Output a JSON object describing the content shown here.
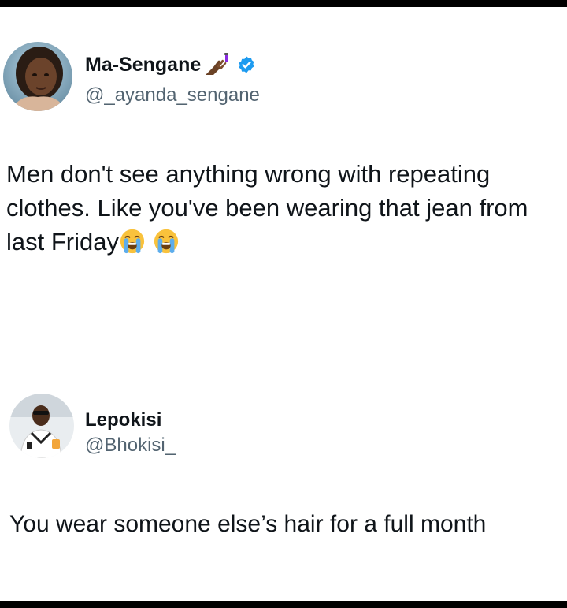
{
  "posts": [
    {
      "display_name": "Ma-Sengane",
      "handle": "@_ayanda_sengane",
      "verified": true,
      "name_icon": "nail-polish-emoji-icon",
      "text_lines": [
        "Men don't see anything wrong with repeating",
        "clothes. Like you've been wearing that jean from",
        "last Friday"
      ],
      "trailing_emojis": [
        "loudly-crying-face-icon",
        "loudly-crying-face-icon"
      ]
    },
    {
      "display_name": "Lepokisi",
      "handle": "@Bhokisi_",
      "verified": false,
      "text_lines": [
        "You wear someone else’s hair for a full month"
      ]
    }
  ],
  "colors": {
    "verified_badge": "#1d9bf0",
    "handle_text": "#536471",
    "body_text": "#0f1419",
    "frame": "#000000"
  }
}
